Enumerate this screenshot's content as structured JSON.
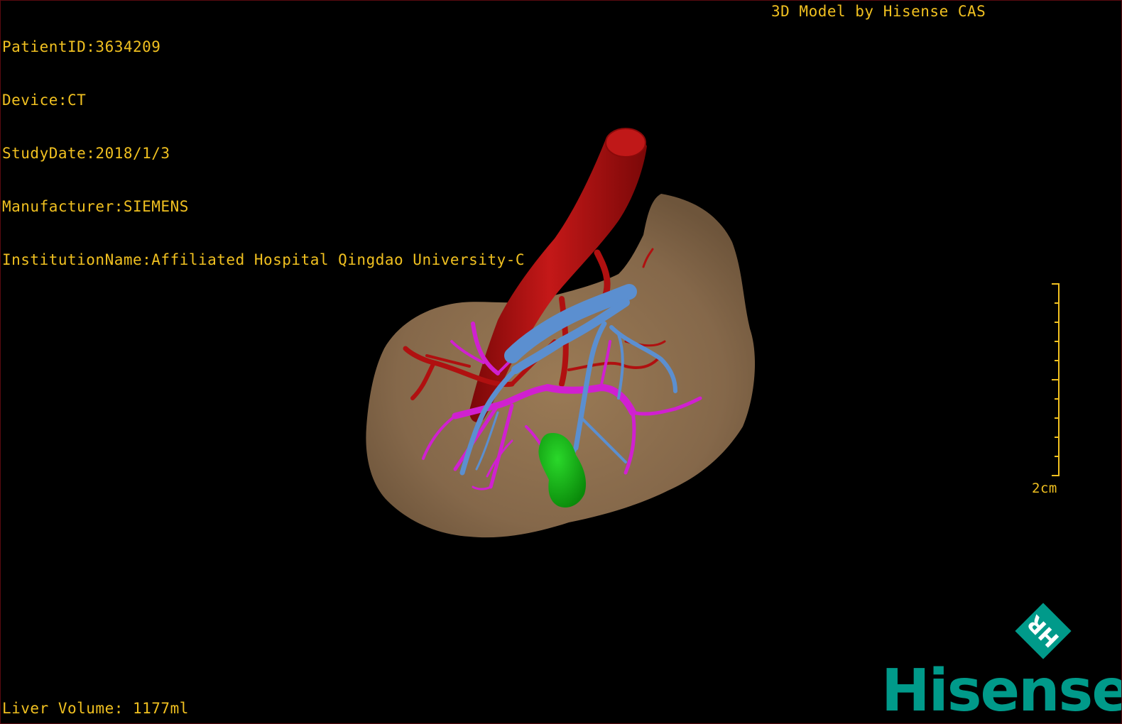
{
  "app": {
    "brand_title": "3D Model by Hisense CAS",
    "logo_text": "Hisense",
    "logo_mark": "HR"
  },
  "dicom_info": {
    "patient_id": "PatientID:3634209",
    "device": "Device:CT",
    "study_date": "StudyDate:2018/1/3",
    "manufacturer": "Manufacturer:SIEMENS",
    "institution": "InstitutionName:Affiliated Hospital Qingdao University-C"
  },
  "measurements": {
    "liver_volume": "Liver Volume: 1177ml",
    "scale_label": "2cm"
  },
  "colors": {
    "overlay_text": "#f0c020",
    "liver": "#8a6a48",
    "artery": "#b01010",
    "portal_vein": "#5b8fd0",
    "hepatic_vein": "#d020d0",
    "gallbladder": "#18b418",
    "logo": "#009a8a"
  },
  "icons": {
    "logo_mark": "hr-diamond-icon",
    "scale": "scale-bar-icon"
  }
}
